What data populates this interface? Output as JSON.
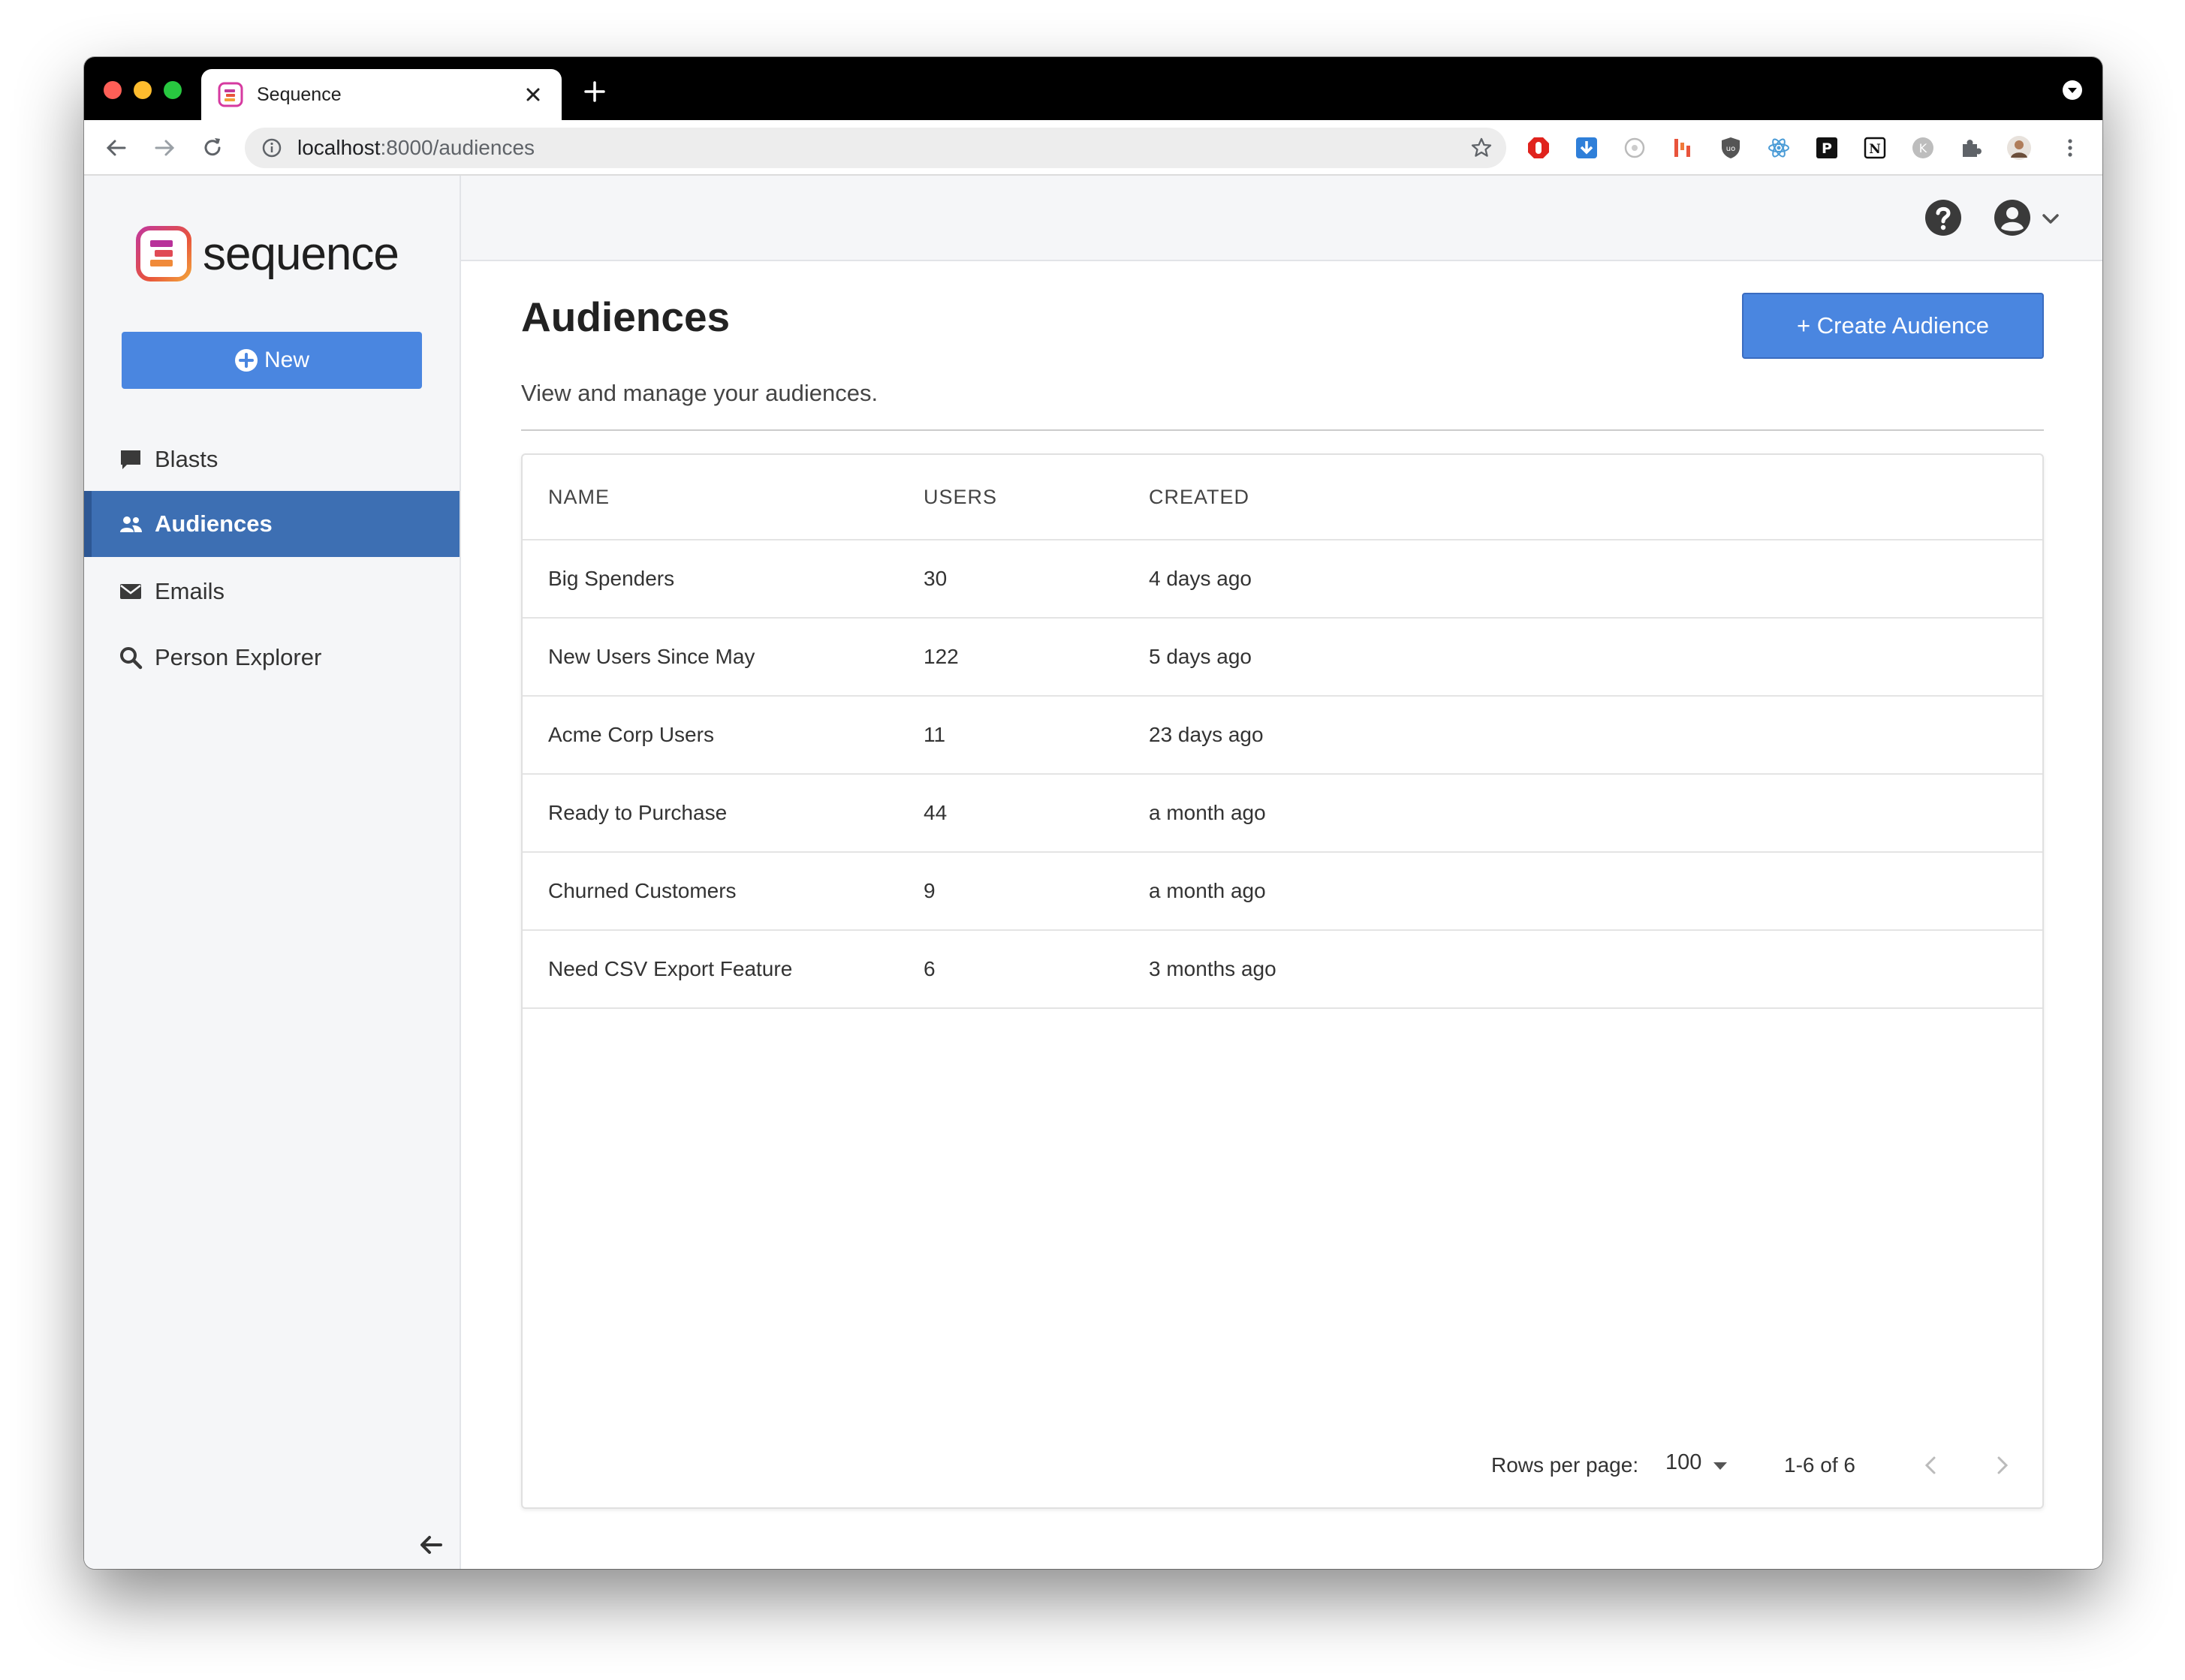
{
  "browser": {
    "tab_title": "Sequence",
    "url_host": "localhost",
    "url_path": ":8000/audiences"
  },
  "sidebar": {
    "logo_text": "sequence",
    "new_button": "New",
    "items": [
      {
        "label": "Blasts",
        "icon": "message-icon",
        "active": false
      },
      {
        "label": "Audiences",
        "icon": "users-icon",
        "active": true
      },
      {
        "label": "Emails",
        "icon": "envelope-icon",
        "active": false
      },
      {
        "label": "Person Explorer",
        "icon": "search-icon",
        "active": false
      }
    ]
  },
  "header": {
    "help_icon": "question-circle-icon",
    "account_icon": "user-circle-icon"
  },
  "main": {
    "title": "Audiences",
    "subtitle": "View and manage your audiences.",
    "create_button": "+ Create Audience",
    "table": {
      "columns": [
        "NAME",
        "USERS",
        "CREATED"
      ],
      "rows": [
        [
          "Big Spenders",
          "30",
          "4 days ago"
        ],
        [
          "New Users Since May",
          "122",
          "5 days ago"
        ],
        [
          "Acme Corp Users",
          "11",
          "23 days ago"
        ],
        [
          "Ready to Purchase",
          "44",
          "a month ago"
        ],
        [
          "Churned Customers",
          "9",
          "a month ago"
        ],
        [
          "Need CSV Export Feature",
          "6",
          "3 months ago"
        ]
      ]
    },
    "pagination": {
      "rows_per_page_label": "Rows per page:",
      "rows_per_page": "100",
      "range": "1-6 of 6"
    }
  },
  "colors": {
    "primary": "#4a86e0",
    "sidebar_active": "#3d6fb3",
    "sidebar_bg": "#f5f6f8"
  }
}
